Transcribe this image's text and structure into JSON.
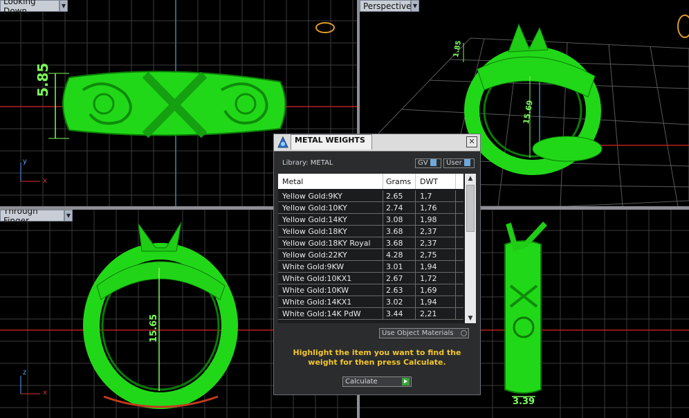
{
  "viewports": {
    "top_left": {
      "label": "Looking Down",
      "dimension": "5.85"
    },
    "top_right": {
      "label": "Perspective",
      "dimension_small": "1.85",
      "dimension_big": "15.69"
    },
    "bottom_left": {
      "label": "Through Finger",
      "dimension": "15.65"
    },
    "bottom_right": {
      "dimension": "3.39"
    }
  },
  "axes": {
    "x": "x",
    "y": "y",
    "z": "z"
  },
  "dialog": {
    "title": "METAL WEIGHTS",
    "close": "✕",
    "library_label": "Library: METAL",
    "toggle_gv": "GV",
    "toggle_user": "User",
    "columns": [
      "Metal",
      "Grams",
      "DWT"
    ],
    "rows": [
      {
        "metal": "Yellow Gold:9KY",
        "grams": "2.65",
        "dwt": "1,7"
      },
      {
        "metal": "Yellow Gold:10KY",
        "grams": "2.74",
        "dwt": "1,76"
      },
      {
        "metal": "Yellow Gold:14KY",
        "grams": "3.08",
        "dwt": "1,98"
      },
      {
        "metal": "Yellow Gold:18KY",
        "grams": "3.68",
        "dwt": "2,37"
      },
      {
        "metal": "Yellow Gold:18KY Royal",
        "grams": "3.68",
        "dwt": "2,37"
      },
      {
        "metal": "Yellow Gold:22KY",
        "grams": "4.28",
        "dwt": "2,75"
      },
      {
        "metal": "White Gold:9KW",
        "grams": "3.01",
        "dwt": "1,94"
      },
      {
        "metal": "White Gold:10KX1",
        "grams": "2.67",
        "dwt": "1,72"
      },
      {
        "metal": "White Gold:10KW",
        "grams": "2.63",
        "dwt": "1,69"
      },
      {
        "metal": "White Gold:14KX1",
        "grams": "3.02",
        "dwt": "1,94"
      },
      {
        "metal": "White Gold:14K PdW",
        "grams": "3.44",
        "dwt": "2,21"
      }
    ],
    "use_object_materials": "Use Object Materials",
    "hint": "Highlight the item you want to find the weight for then press Calculate.",
    "calculate": "Calculate"
  },
  "colors": {
    "ring": "#22e01a",
    "grid": "#4a4a4a",
    "dim": "#7cfc5a",
    "hint": "#f3c62b"
  }
}
